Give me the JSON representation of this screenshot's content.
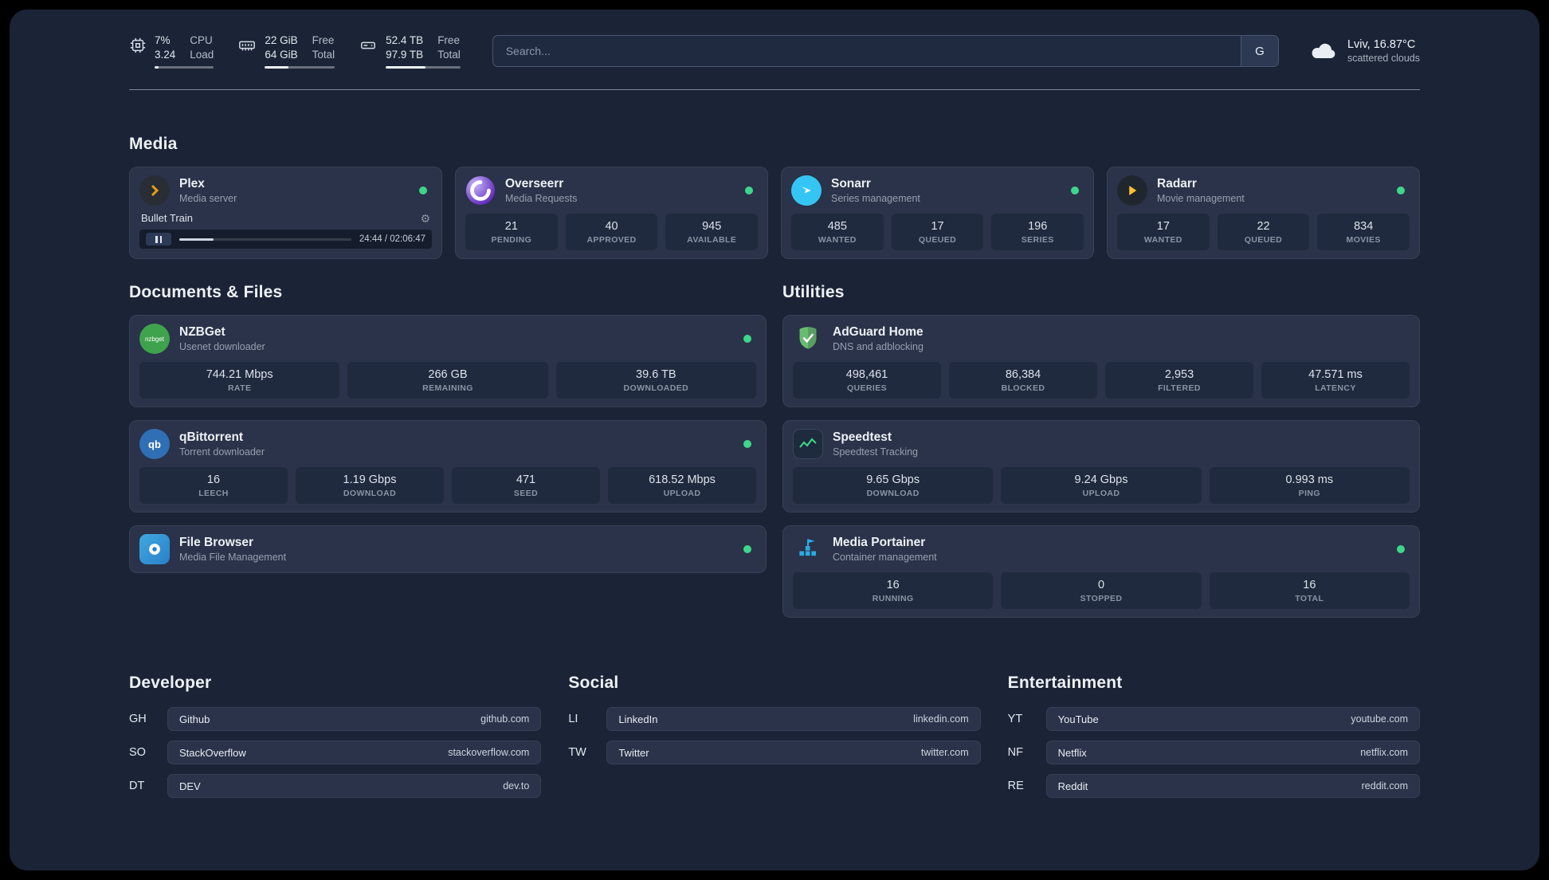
{
  "topbar": {
    "cpu": {
      "value_top": "7%",
      "value_bottom": "3.24",
      "label_top": "CPU",
      "label_bottom": "Load"
    },
    "ram": {
      "value_top": "22 GiB",
      "value_bottom": "64 GiB",
      "label_top": "Free",
      "label_bottom": "Total"
    },
    "disk": {
      "value_top": "52.4 TB",
      "value_bottom": "97.9 TB",
      "label_top": "Free",
      "label_bottom": "Total"
    },
    "search": {
      "placeholder": "Search...",
      "provider": "G"
    },
    "weather": {
      "line1": "Lviv, 16.87°C",
      "line2": "scattered clouds"
    }
  },
  "sections": {
    "media": {
      "title": "Media",
      "plex": {
        "name": "Plex",
        "desc": "Media server",
        "track": "Bullet Train",
        "time": "24:44 / 02:06:47"
      },
      "overseerr": {
        "name": "Overseerr",
        "desc": "Media Requests",
        "stats": [
          {
            "value": "21",
            "label": "PENDING"
          },
          {
            "value": "40",
            "label": "APPROVED"
          },
          {
            "value": "945",
            "label": "AVAILABLE"
          }
        ]
      },
      "sonarr": {
        "name": "Sonarr",
        "desc": "Series management",
        "stats": [
          {
            "value": "485",
            "label": "WANTED"
          },
          {
            "value": "17",
            "label": "QUEUED"
          },
          {
            "value": "196",
            "label": "SERIES"
          }
        ]
      },
      "radarr": {
        "name": "Radarr",
        "desc": "Movie management",
        "stats": [
          {
            "value": "17",
            "label": "WANTED"
          },
          {
            "value": "22",
            "label": "QUEUED"
          },
          {
            "value": "834",
            "label": "MOVIES"
          }
        ]
      }
    },
    "documents": {
      "title": "Documents & Files",
      "nzbget": {
        "name": "NZBGet",
        "desc": "Usenet downloader",
        "stats": [
          {
            "value": "744.21 Mbps",
            "label": "RATE"
          },
          {
            "value": "266 GB",
            "label": "REMAINING"
          },
          {
            "value": "39.6 TB",
            "label": "DOWNLOADED"
          }
        ]
      },
      "qbittorrent": {
        "name": "qBittorrent",
        "desc": "Torrent downloader",
        "stats": [
          {
            "value": "16",
            "label": "LEECH"
          },
          {
            "value": "1.19 Gbps",
            "label": "DOWNLOAD"
          },
          {
            "value": "471",
            "label": "SEED"
          },
          {
            "value": "618.52 Mbps",
            "label": "UPLOAD"
          }
        ]
      },
      "filebrowser": {
        "name": "File Browser",
        "desc": "Media File Management"
      }
    },
    "utilities": {
      "title": "Utilities",
      "adguard": {
        "name": "AdGuard Home",
        "desc": "DNS and adblocking",
        "stats": [
          {
            "value": "498,461",
            "label": "QUERIES"
          },
          {
            "value": "86,384",
            "label": "BLOCKED"
          },
          {
            "value": "2,953",
            "label": "FILTERED"
          },
          {
            "value": "47.571 ms",
            "label": "LATENCY"
          }
        ]
      },
      "speedtest": {
        "name": "Speedtest",
        "desc": "Speedtest Tracking",
        "stats": [
          {
            "value": "9.65 Gbps",
            "label": "DOWNLOAD"
          },
          {
            "value": "9.24 Gbps",
            "label": "UPLOAD"
          },
          {
            "value": "0.993 ms",
            "label": "PING"
          }
        ]
      },
      "portainer": {
        "name": "Media Portainer",
        "desc": "Container management",
        "stats": [
          {
            "value": "16",
            "label": "RUNNING"
          },
          {
            "value": "0",
            "label": "STOPPED"
          },
          {
            "value": "16",
            "label": "TOTAL"
          }
        ]
      }
    }
  },
  "bookmarks": {
    "developer": {
      "title": "Developer",
      "items": [
        {
          "abbr": "GH",
          "name": "Github",
          "url": "github.com"
        },
        {
          "abbr": "SO",
          "name": "StackOverflow",
          "url": "stackoverflow.com"
        },
        {
          "abbr": "DT",
          "name": "DEV",
          "url": "dev.to"
        }
      ]
    },
    "social": {
      "title": "Social",
      "items": [
        {
          "abbr": "LI",
          "name": "LinkedIn",
          "url": "linkedin.com"
        },
        {
          "abbr": "TW",
          "name": "Twitter",
          "url": "twitter.com"
        }
      ]
    },
    "entertainment": {
      "title": "Entertainment",
      "items": [
        {
          "abbr": "YT",
          "name": "YouTube",
          "url": "youtube.com"
        },
        {
          "abbr": "NF",
          "name": "Netflix",
          "url": "netflix.com"
        },
        {
          "abbr": "RE",
          "name": "Reddit",
          "url": "reddit.com"
        }
      ]
    }
  },
  "colors": {
    "status_green": "#3ed68a",
    "plex_amber": "#e5a00d",
    "sonarr_blue": "#35c5f4",
    "radarr_yellow": "#ffc230"
  }
}
